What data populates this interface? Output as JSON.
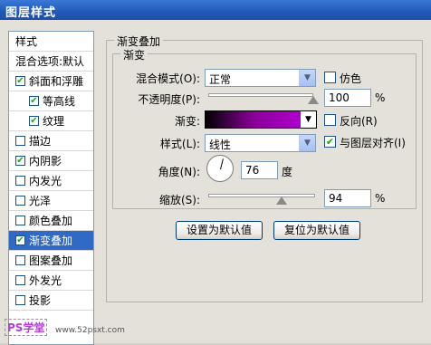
{
  "window": {
    "title": "图层样式"
  },
  "sidebar": {
    "items": [
      {
        "label": "样式",
        "checkbox": false,
        "checked": false,
        "selected": false,
        "sub": false
      },
      {
        "label": "混合选项:默认",
        "checkbox": false,
        "checked": false,
        "selected": false,
        "sub": false
      },
      {
        "label": "斜面和浮雕",
        "checkbox": true,
        "checked": true,
        "selected": false,
        "sub": false
      },
      {
        "label": "等高线",
        "checkbox": true,
        "checked": true,
        "selected": false,
        "sub": true
      },
      {
        "label": "纹理",
        "checkbox": true,
        "checked": true,
        "selected": false,
        "sub": true
      },
      {
        "label": "描边",
        "checkbox": true,
        "checked": false,
        "selected": false,
        "sub": false
      },
      {
        "label": "内阴影",
        "checkbox": true,
        "checked": true,
        "selected": false,
        "sub": false
      },
      {
        "label": "内发光",
        "checkbox": true,
        "checked": false,
        "selected": false,
        "sub": false
      },
      {
        "label": "光泽",
        "checkbox": true,
        "checked": false,
        "selected": false,
        "sub": false
      },
      {
        "label": "颜色叠加",
        "checkbox": true,
        "checked": false,
        "selected": false,
        "sub": false
      },
      {
        "label": "渐变叠加",
        "checkbox": true,
        "checked": true,
        "selected": true,
        "sub": false
      },
      {
        "label": "图案叠加",
        "checkbox": true,
        "checked": false,
        "selected": false,
        "sub": false
      },
      {
        "label": "外发光",
        "checkbox": true,
        "checked": false,
        "selected": false,
        "sub": false
      },
      {
        "label": "投影",
        "checkbox": true,
        "checked": false,
        "selected": false,
        "sub": false
      }
    ]
  },
  "panel": {
    "group_title": "渐变叠加",
    "sub_group_title": "渐变",
    "blend_mode": {
      "label": "混合模式(O):",
      "value": "正常"
    },
    "dither": {
      "label": "仿色",
      "checked": false
    },
    "opacity": {
      "label": "不透明度(P):",
      "value": "100",
      "unit": "%",
      "level": 1.0
    },
    "gradient": {
      "label": "渐变:",
      "colors": [
        "#000000",
        "#8a0098",
        "#b000d0"
      ]
    },
    "reverse": {
      "label": "反向(R)",
      "checked": false
    },
    "style": {
      "label": "样式(L):",
      "value": "线性"
    },
    "align": {
      "label": "与图层对齐(I)",
      "checked": true
    },
    "angle": {
      "label": "角度(N):",
      "value": "76",
      "unit": "度"
    },
    "scale": {
      "label": "缩放(S):",
      "value": "94",
      "unit": "%",
      "level": 0.94
    },
    "reset_default_button": "设置为默认值",
    "restore_default_button": "复位为默认值"
  },
  "watermark": {
    "logo": "PS学堂",
    "site": "www.52psxt.com"
  },
  "colors": {
    "titlebar": "#2158b8",
    "selection": "#316ac5",
    "check": "#21a121"
  }
}
